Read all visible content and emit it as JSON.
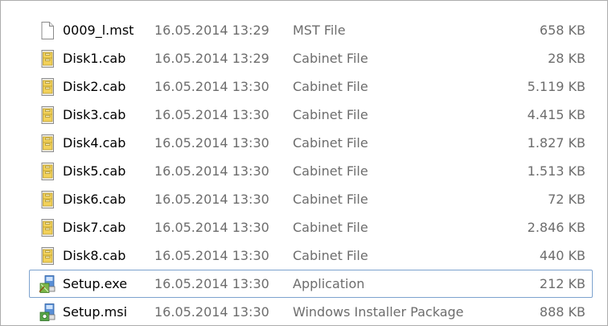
{
  "files": [
    {
      "name": "0009_l.mst",
      "date": "16.05.2014 13:29",
      "type": "MST File",
      "size": "658 KB",
      "icon": "document-icon"
    },
    {
      "name": "Disk1.cab",
      "date": "16.05.2014 13:29",
      "type": "Cabinet File",
      "size": "28 KB",
      "icon": "cabinet-file-icon"
    },
    {
      "name": "Disk2.cab",
      "date": "16.05.2014 13:30",
      "type": "Cabinet File",
      "size": "5.119 KB",
      "icon": "cabinet-file-icon"
    },
    {
      "name": "Disk3.cab",
      "date": "16.05.2014 13:30",
      "type": "Cabinet File",
      "size": "4.415 KB",
      "icon": "cabinet-file-icon"
    },
    {
      "name": "Disk4.cab",
      "date": "16.05.2014 13:30",
      "type": "Cabinet File",
      "size": "1.827 KB",
      "icon": "cabinet-file-icon"
    },
    {
      "name": "Disk5.cab",
      "date": "16.05.2014 13:30",
      "type": "Cabinet File",
      "size": "1.513 KB",
      "icon": "cabinet-file-icon"
    },
    {
      "name": "Disk6.cab",
      "date": "16.05.2014 13:30",
      "type": "Cabinet File",
      "size": "72 KB",
      "icon": "cabinet-file-icon"
    },
    {
      "name": "Disk7.cab",
      "date": "16.05.2014 13:30",
      "type": "Cabinet File",
      "size": "2.846 KB",
      "icon": "cabinet-file-icon"
    },
    {
      "name": "Disk8.cab",
      "date": "16.05.2014 13:30",
      "type": "Cabinet File",
      "size": "440 KB",
      "icon": "cabinet-file-icon"
    },
    {
      "name": "Setup.exe",
      "date": "16.05.2014 13:30",
      "type": "Application",
      "size": "212 KB",
      "icon": "setup-application-icon",
      "focused": true
    },
    {
      "name": "Setup.msi",
      "date": "16.05.2014 13:30",
      "type": "Windows Installer Package",
      "size": "888 KB",
      "icon": "installer-package-icon"
    }
  ],
  "colors": {
    "name_text": "#000000",
    "detail_text": "#6d6d6d",
    "focus_border": "#7da2ce",
    "cabinet_icon_fill": "#f2d15a"
  }
}
